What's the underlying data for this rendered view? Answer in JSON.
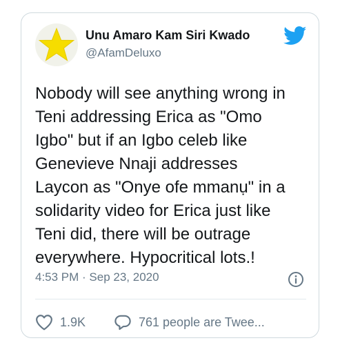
{
  "tweet": {
    "author_name": "Unu Amaro Kam Siri Kwado",
    "author_handle": "@AfamDeluxo",
    "text": "Nobody will see anything wrong in\nTeni addressing Erica as \"Omo\nIgbo\" but if an Igbo celeb like\nGenevieve Nnaji addresses\nLaycon as \"Onye ofe mmanụ\" in a\nsolidarity video for Erica just like\nTeni did, there will be outrage\neverywhere. Hypocritical lots.!",
    "timestamp": "4:53 PM · Sep 23, 2020"
  },
  "actions": {
    "like_count": "1.9K",
    "reply_label": "761 people are Twee..."
  },
  "icons": {
    "avatar": "star-icon",
    "brand": "twitter-bird-icon",
    "info": "info-icon",
    "like": "heart-icon",
    "reply": "speech-bubble-icon"
  },
  "colors": {
    "brand": "#1da1f2",
    "star": "#f6dd00",
    "text": "#14171a",
    "secondary": "#657786",
    "border": "#cfd9de"
  }
}
